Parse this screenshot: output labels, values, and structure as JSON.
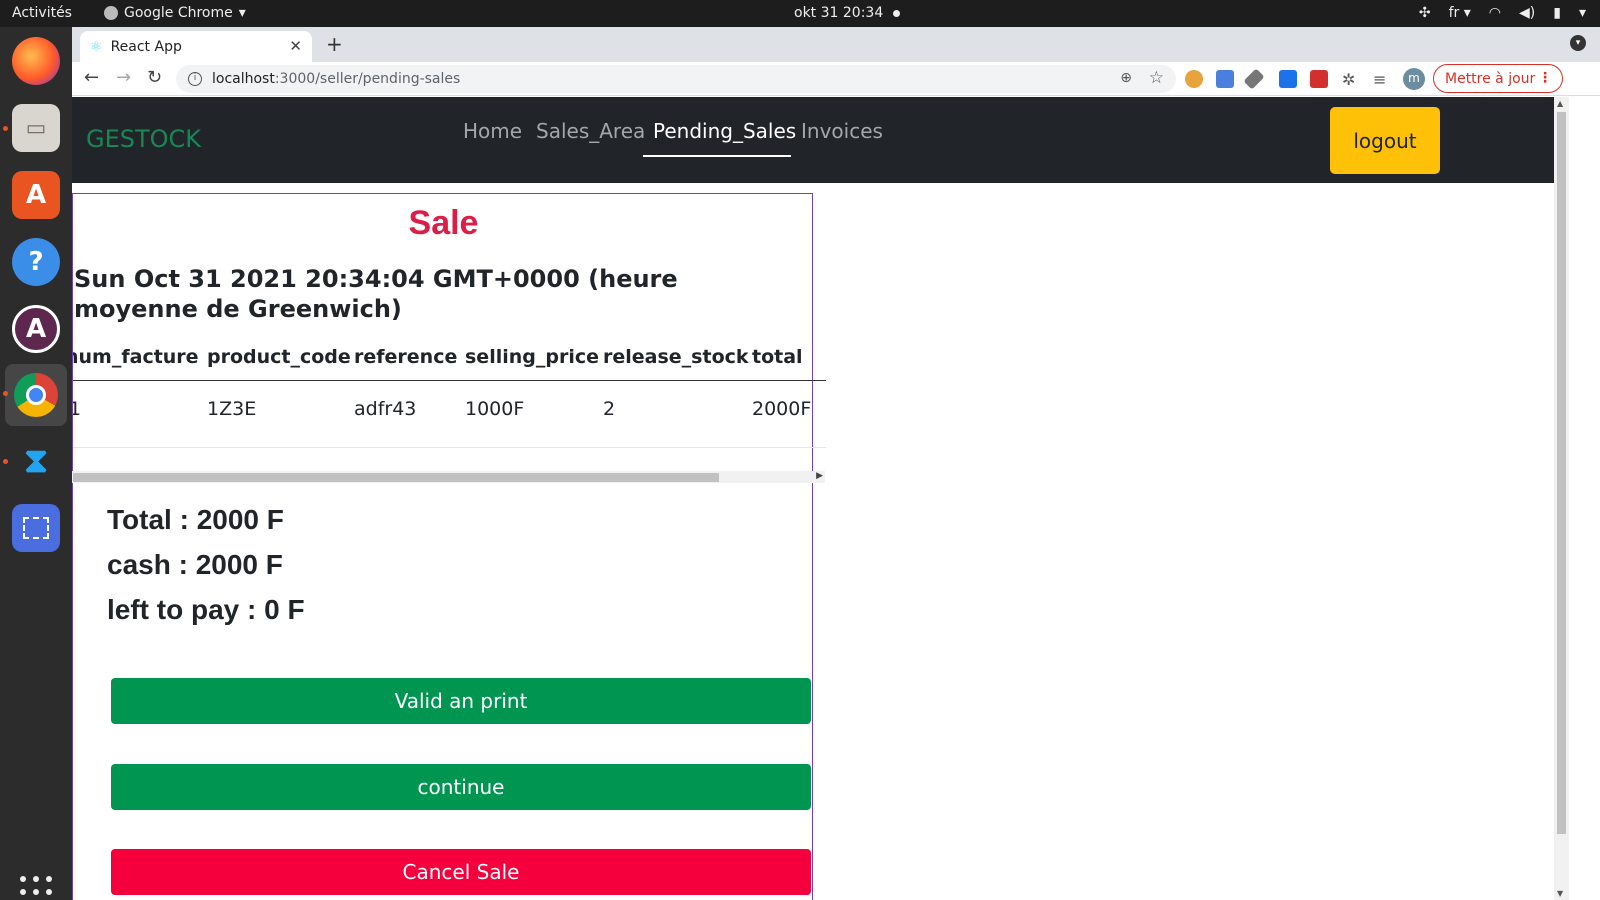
{
  "system": {
    "activities": "Activités",
    "app_menu": "Google Chrome",
    "clock": "okt 31  20:34",
    "lang": "fr"
  },
  "browser": {
    "tab_title": "React App",
    "url_host": "localhost",
    "url_path": ":3000/seller/pending-sales",
    "avatar_letter": "m",
    "update_label": "Mettre à jour"
  },
  "navbar": {
    "brand": "GESTOCK",
    "links": [
      "Home",
      "Sales_Area",
      "Pending_Sales",
      "Invoices"
    ],
    "active_link": "Pending_Sales",
    "logout_label": "logout"
  },
  "sale": {
    "title": "Sale",
    "date": "Sun Oct 31 2021 20:34:04 GMT+0000 (heure moyenne de Greenwich)",
    "columns": [
      "num_facture",
      "product_code",
      "reference",
      "selling_price",
      "release_stock",
      "total"
    ],
    "rows": [
      [
        "1",
        "1Z3E",
        "adfr43",
        "1000F",
        "2",
        "2000F"
      ]
    ],
    "total": "Total : 2000 F",
    "cash": "cash : 2000 F",
    "left_to_pay": "left to pay : 0 F",
    "buttons": {
      "valid_print": "Valid an print",
      "continue": "continue",
      "cancel": "Cancel Sale"
    }
  },
  "colors": {
    "brand_green": "#198754",
    "sale_title": "#dc1d48",
    "primary_action": "#009652",
    "danger_action": "#f5003d",
    "logout": "#ffc107"
  }
}
